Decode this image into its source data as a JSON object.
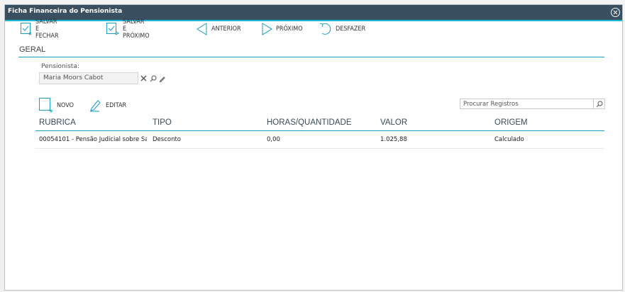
{
  "window": {
    "title": "Ficha Financeira do Pensionista"
  },
  "toolbar": {
    "save_close": "SALVAR E FECHAR",
    "save_next": "SALVAR E PRÓXIMO",
    "previous": "ANTERIOR",
    "next": "PRÓXIMO",
    "undo": "DESFAZER"
  },
  "section": {
    "title": "GERAL"
  },
  "pensioner": {
    "label": "Pensionista:",
    "value": "Maria Moors Cabot"
  },
  "grid_toolbar": {
    "new": "NOVO",
    "edit": "EDITAR"
  },
  "search": {
    "placeholder": "Procurar Registros"
  },
  "table": {
    "columns": [
      "RUBRICA",
      "TIPO",
      "HORAS/QUANTIDADE",
      "VALOR",
      "ORIGEM"
    ],
    "rows": [
      [
        "00054101 - Pensão Judicial sobre Sa...",
        "Desconto",
        "0,00",
        "1.025,88",
        "Calculado"
      ]
    ]
  },
  "colors": {
    "titlebar": "#3a4f5f",
    "accent": "#1eb4d4",
    "rule": "#1a9dc1",
    "icon": "#1a9dc1"
  }
}
